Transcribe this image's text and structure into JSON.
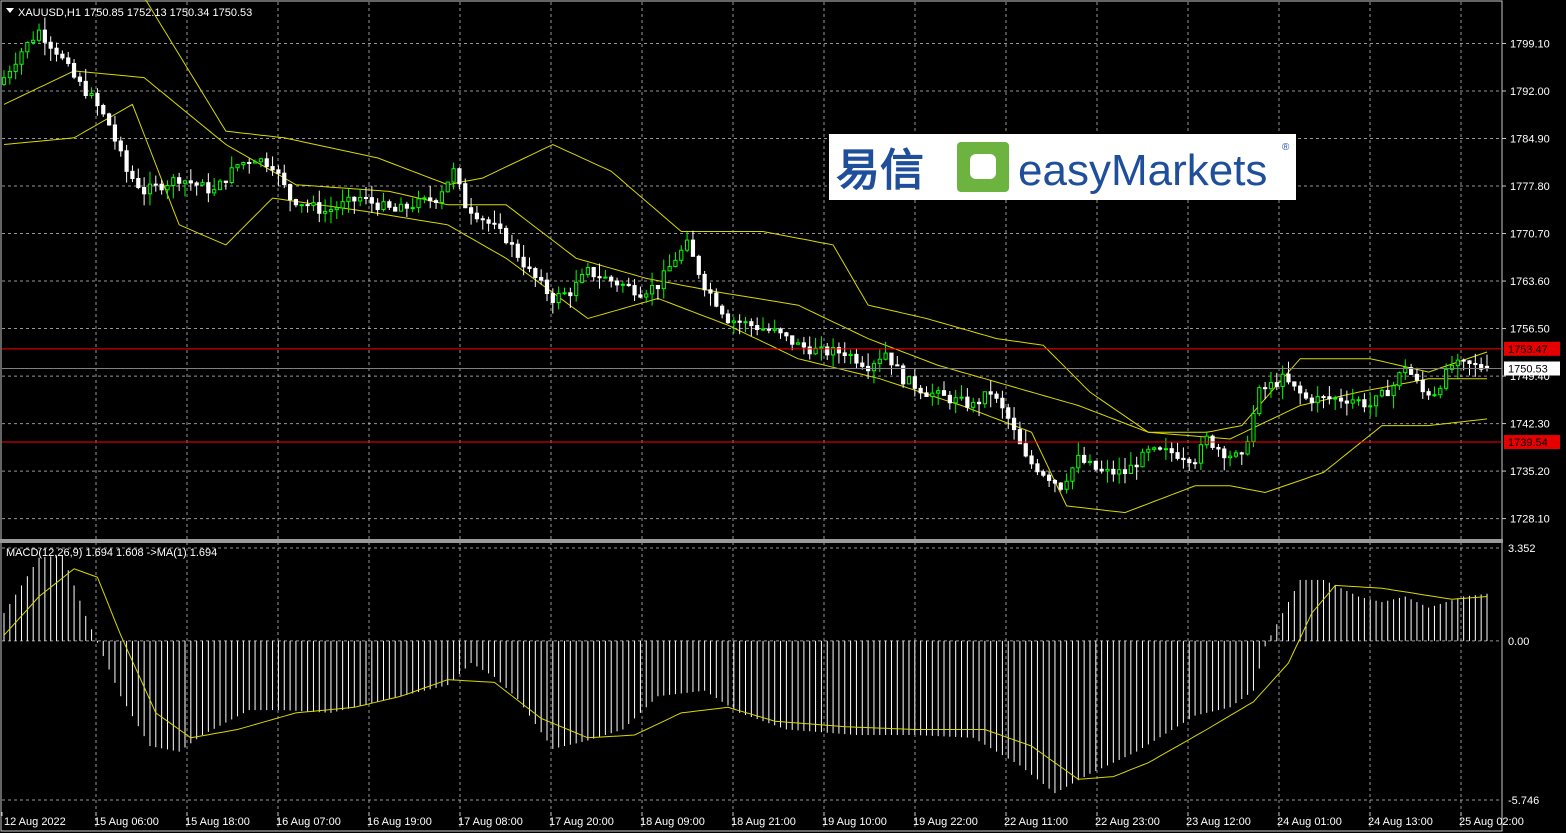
{
  "header": {
    "symbol_line": "XAUUSD,H1  1750.85 1752.13 1750.34 1750.53",
    "macd_line": "MACD(12,26,9) 1.694 1.608  ->MA(1) 1.694"
  },
  "logo": {
    "chinese": "易信",
    "brand": "easyMarkets",
    "registered": "®"
  },
  "colors": {
    "background": "#000000",
    "grid": "#c8c8c8",
    "bull": "#00ff00",
    "bear": "#ffffff",
    "bands": "#d8d800",
    "level_line": "#ff0000",
    "current_price_line": "#808080",
    "macd_signal": "#d8d800",
    "macd_hist": "#ffffff"
  },
  "price_axis": {
    "ticks": [
      "1799.10",
      "1792.00",
      "1784.90",
      "1777.80",
      "1770.70",
      "1763.60",
      "1756.50",
      "1749.40",
      "1742.30",
      "1735.20",
      "1728.10"
    ],
    "current_price": "1750.53",
    "resistance": "1753.47",
    "support": "1739.54"
  },
  "macd_axis": {
    "ticks": [
      "3.352",
      "0.00",
      "-5.746"
    ]
  },
  "time_axis": {
    "labels": [
      "12 Aug 2022",
      "15 Aug 06:00",
      "15 Aug 18:00",
      "16 Aug 07:00",
      "16 Aug 19:00",
      "17 Aug 08:00",
      "17 Aug 20:00",
      "18 Aug 09:00",
      "18 Aug 21:00",
      "19 Aug 10:00",
      "19 Aug 22:00",
      "22 Aug 11:00",
      "22 Aug 23:00",
      "23 Aug 12:00",
      "24 Aug 01:00",
      "24 Aug 13:00",
      "25 Aug 02:00"
    ]
  },
  "chart_data": [
    {
      "type": "candlestick",
      "symbol": "XAUUSD",
      "timeframe": "H1",
      "last_ohlc": {
        "open": 1750.85,
        "high": 1752.13,
        "low": 1750.34,
        "close": 1750.53
      },
      "ylim": [
        1725.5,
        1805.0
      ],
      "indicators": [
        "Bollinger Bands"
      ],
      "horizontal_levels": [
        1753.47,
        1739.54,
        1750.53
      ],
      "close_path": [
        [
          0,
          1794
        ],
        [
          3,
          1798
        ],
        [
          6,
          1801
        ],
        [
          9,
          1798
        ],
        [
          12,
          1794
        ],
        [
          15,
          1791
        ],
        [
          18,
          1787
        ],
        [
          21,
          1780
        ],
        [
          24,
          1777
        ],
        [
          27,
          1778
        ],
        [
          30,
          1779
        ],
        [
          33,
          1778
        ],
        [
          36,
          1777
        ],
        [
          40,
          1781
        ],
        [
          43,
          1782
        ],
        [
          46,
          1781
        ],
        [
          49,
          1776
        ],
        [
          52,
          1775
        ],
        [
          55,
          1774
        ],
        [
          58,
          1775
        ],
        [
          61,
          1776
        ],
        [
          64,
          1775
        ],
        [
          67,
          1774
        ],
        [
          70,
          1775
        ],
        [
          74,
          1776
        ],
        [
          77,
          1780
        ],
        [
          79,
          1775
        ],
        [
          82,
          1773
        ],
        [
          86,
          1770
        ],
        [
          90,
          1765
        ],
        [
          94,
          1761
        ],
        [
          97,
          1762
        ],
        [
          100,
          1765
        ],
        [
          103,
          1764
        ],
        [
          106,
          1763
        ],
        [
          109,
          1762
        ],
        [
          112,
          1763
        ],
        [
          115,
          1767
        ],
        [
          117,
          1769
        ],
        [
          120,
          1763
        ],
        [
          124,
          1758
        ],
        [
          128,
          1757
        ],
        [
          132,
          1756
        ],
        [
          136,
          1754
        ],
        [
          140,
          1753
        ],
        [
          144,
          1753
        ],
        [
          148,
          1751
        ],
        [
          151,
          1753
        ],
        [
          154,
          1749
        ],
        [
          158,
          1747
        ],
        [
          162,
          1746
        ],
        [
          166,
          1745
        ],
        [
          169,
          1747
        ],
        [
          172,
          1743
        ],
        [
          175,
          1737
        ],
        [
          178,
          1735
        ],
        [
          181,
          1733
        ],
        [
          184,
          1737
        ],
        [
          188,
          1735
        ],
        [
          192,
          1735
        ],
        [
          196,
          1738
        ],
        [
          200,
          1738
        ],
        [
          204,
          1737
        ],
        [
          206,
          1740
        ],
        [
          209,
          1738
        ],
        [
          212,
          1737
        ],
        [
          215,
          1747
        ],
        [
          219,
          1749
        ],
        [
          223,
          1746
        ],
        [
          227,
          1746
        ],
        [
          231,
          1746
        ],
        [
          234,
          1745
        ],
        [
          238,
          1748
        ],
        [
          240,
          1751
        ],
        [
          243,
          1747
        ],
        [
          245,
          1747
        ],
        [
          248,
          1751
        ],
        [
          251,
          1751
        ],
        [
          254,
          1750.5
        ]
      ],
      "bollinger": {
        "upper": [
          [
            0,
            1812
          ],
          [
            12,
            1812
          ],
          [
            24,
            1806
          ],
          [
            38,
            1786
          ],
          [
            48,
            1785
          ],
          [
            64,
            1782
          ],
          [
            76,
            1778
          ],
          [
            82,
            1779
          ],
          [
            94,
            1784
          ],
          [
            104,
            1780
          ],
          [
            116,
            1771
          ],
          [
            130,
            1771
          ],
          [
            142,
            1769
          ],
          [
            148,
            1760
          ],
          [
            158,
            1758
          ],
          [
            170,
            1755
          ],
          [
            178,
            1754
          ],
          [
            186,
            1747
          ],
          [
            196,
            1741
          ],
          [
            206,
            1741
          ],
          [
            212,
            1742
          ],
          [
            222,
            1752
          ],
          [
            234,
            1752
          ],
          [
            244,
            1750
          ],
          [
            254,
            1753
          ]
        ],
        "middle": [
          [
            0,
            1790
          ],
          [
            12,
            1795
          ],
          [
            24,
            1794
          ],
          [
            38,
            1784
          ],
          [
            50,
            1778
          ],
          [
            66,
            1777
          ],
          [
            76,
            1775
          ],
          [
            86,
            1775
          ],
          [
            98,
            1767
          ],
          [
            110,
            1764
          ],
          [
            122,
            1762
          ],
          [
            136,
            1760
          ],
          [
            148,
            1755
          ],
          [
            160,
            1751
          ],
          [
            172,
            1748
          ],
          [
            184,
            1745
          ],
          [
            196,
            1741
          ],
          [
            210,
            1740
          ],
          [
            222,
            1745
          ],
          [
            232,
            1747
          ],
          [
            244,
            1749
          ],
          [
            254,
            1749
          ]
        ],
        "lower": [
          [
            0,
            1784
          ],
          [
            12,
            1785
          ],
          [
            22,
            1790
          ],
          [
            30,
            1772
          ],
          [
            38,
            1769
          ],
          [
            46,
            1776
          ],
          [
            62,
            1774
          ],
          [
            76,
            1772
          ],
          [
            86,
            1767
          ],
          [
            100,
            1758
          ],
          [
            112,
            1761
          ],
          [
            124,
            1757
          ],
          [
            136,
            1752
          ],
          [
            150,
            1749
          ],
          [
            164,
            1745
          ],
          [
            176,
            1741
          ],
          [
            182,
            1730
          ],
          [
            192,
            1729
          ],
          [
            204,
            1733
          ],
          [
            210,
            1733
          ],
          [
            216,
            1732
          ],
          [
            226,
            1735
          ],
          [
            236,
            1742
          ],
          [
            244,
            1742
          ],
          [
            254,
            1743
          ]
        ]
      }
    },
    {
      "type": "macd",
      "name": "MACD(12,26,9)",
      "values": {
        "main": 1.694,
        "signal": 1.608,
        "ma": 1.694
      },
      "ylim": [
        -5.746,
        3.352
      ],
      "histogram_path": [
        [
          0,
          1.0
        ],
        [
          6,
          3.0
        ],
        [
          10,
          3.1
        ],
        [
          14,
          0.9
        ],
        [
          20,
          -2.0
        ],
        [
          25,
          -3.8
        ],
        [
          30,
          -4.0
        ],
        [
          34,
          -3.4
        ],
        [
          42,
          -2.5
        ],
        [
          48,
          -2.5
        ],
        [
          56,
          -2.6
        ],
        [
          66,
          -2.1
        ],
        [
          76,
          -1.6
        ],
        [
          80,
          -0.8
        ],
        [
          84,
          -1.3
        ],
        [
          88,
          -2.1
        ],
        [
          94,
          -3.9
        ],
        [
          100,
          -3.6
        ],
        [
          106,
          -3.2
        ],
        [
          112,
          -2.0
        ],
        [
          120,
          -1.8
        ],
        [
          126,
          -2.6
        ],
        [
          134,
          -3.2
        ],
        [
          146,
          -3.4
        ],
        [
          156,
          -3.4
        ],
        [
          166,
          -3.5
        ],
        [
          174,
          -4.5
        ],
        [
          180,
          -5.5
        ],
        [
          186,
          -4.8
        ],
        [
          194,
          -4.0
        ],
        [
          204,
          -2.7
        ],
        [
          210,
          -2.4
        ],
        [
          214,
          -1.8
        ],
        [
          216,
          -0.2
        ],
        [
          222,
          2.2
        ],
        [
          226,
          2.2
        ],
        [
          232,
          1.6
        ],
        [
          236,
          1.4
        ],
        [
          240,
          1.6
        ],
        [
          244,
          1.2
        ],
        [
          250,
          1.6
        ],
        [
          254,
          1.7
        ]
      ],
      "signal_path": [
        [
          0,
          0.2
        ],
        [
          6,
          1.6
        ],
        [
          12,
          2.6
        ],
        [
          16,
          2.3
        ],
        [
          20,
          0.2
        ],
        [
          26,
          -2.6
        ],
        [
          32,
          -3.5
        ],
        [
          40,
          -3.2
        ],
        [
          50,
          -2.6
        ],
        [
          60,
          -2.4
        ],
        [
          68,
          -2.0
        ],
        [
          76,
          -1.4
        ],
        [
          84,
          -1.5
        ],
        [
          92,
          -2.8
        ],
        [
          100,
          -3.5
        ],
        [
          108,
          -3.4
        ],
        [
          116,
          -2.6
        ],
        [
          124,
          -2.4
        ],
        [
          132,
          -2.9
        ],
        [
          144,
          -3.1
        ],
        [
          156,
          -3.2
        ],
        [
          168,
          -3.2
        ],
        [
          176,
          -3.8
        ],
        [
          184,
          -5.0
        ],
        [
          190,
          -4.9
        ],
        [
          196,
          -4.4
        ],
        [
          206,
          -3.2
        ],
        [
          214,
          -2.2
        ],
        [
          220,
          -0.8
        ],
        [
          224,
          1.0
        ],
        [
          228,
          2.0
        ],
        [
          236,
          1.9
        ],
        [
          242,
          1.7
        ],
        [
          248,
          1.5
        ],
        [
          254,
          1.6
        ]
      ]
    }
  ]
}
